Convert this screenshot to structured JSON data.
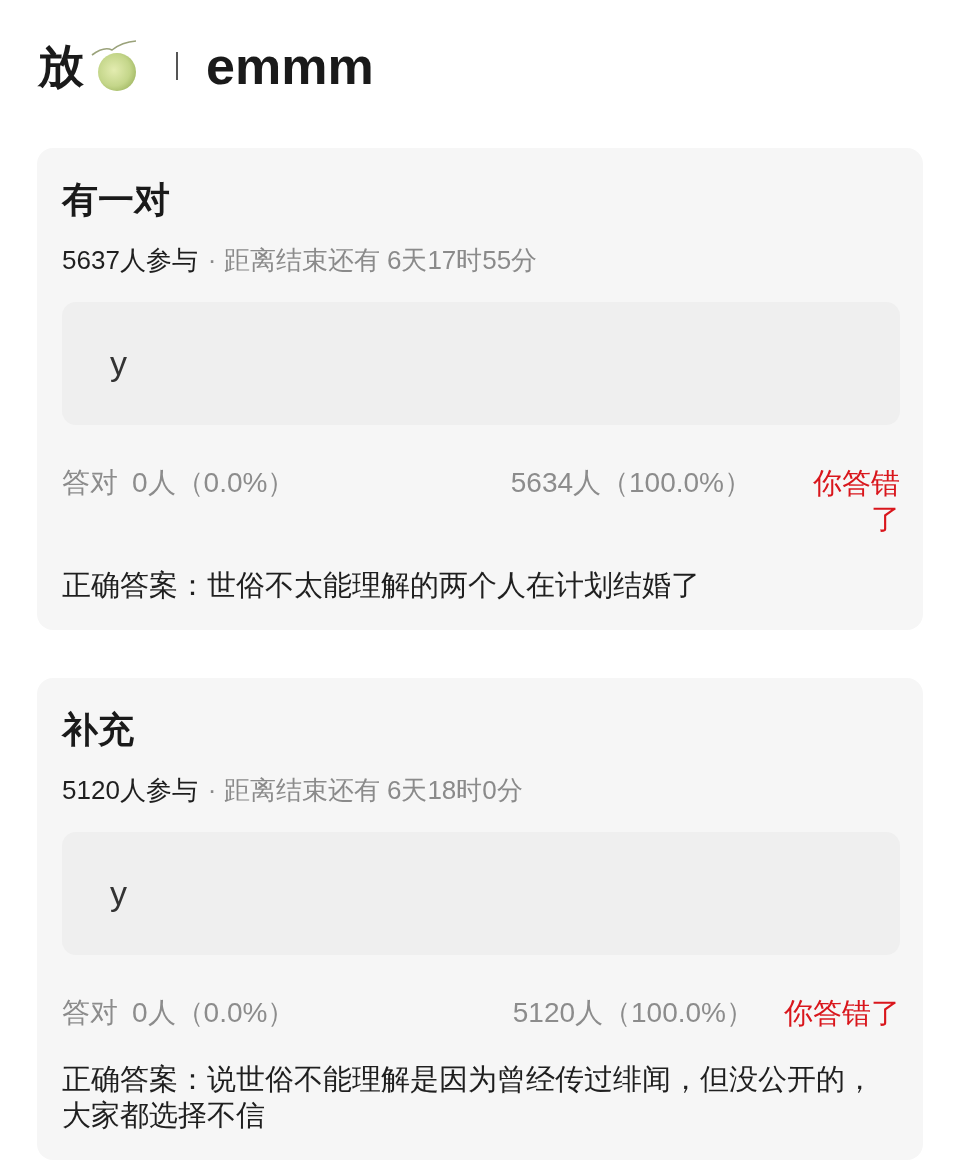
{
  "header": {
    "title": "放",
    "subtitle": "emmm"
  },
  "quizzes": [
    {
      "title": "有一对",
      "participants": "5637人参与",
      "deadline": "· 距离结束还有 6天17时55分",
      "options": [
        {
          "label": "y"
        }
      ],
      "correct_label": "答对",
      "correct_count": "0人（0.0%）",
      "wrong_count": "5634人（100.0%）",
      "verdict": "你答错了",
      "answer": "正确答案：世俗不太能理解的两个人在计划结婚了"
    },
    {
      "title": "补充",
      "participants": "5120人参与",
      "deadline": "· 距离结束还有 6天18时0分",
      "options": [
        {
          "label": "y"
        }
      ],
      "correct_label": "答对",
      "correct_count": "0人（0.0%）",
      "wrong_count": "5120人（100.0%）",
      "verdict": "你答错了",
      "answer": "正确答案：说世俗不能理解是因为曾经传过绯闻，但没公开的，大家都选择不信"
    }
  ]
}
